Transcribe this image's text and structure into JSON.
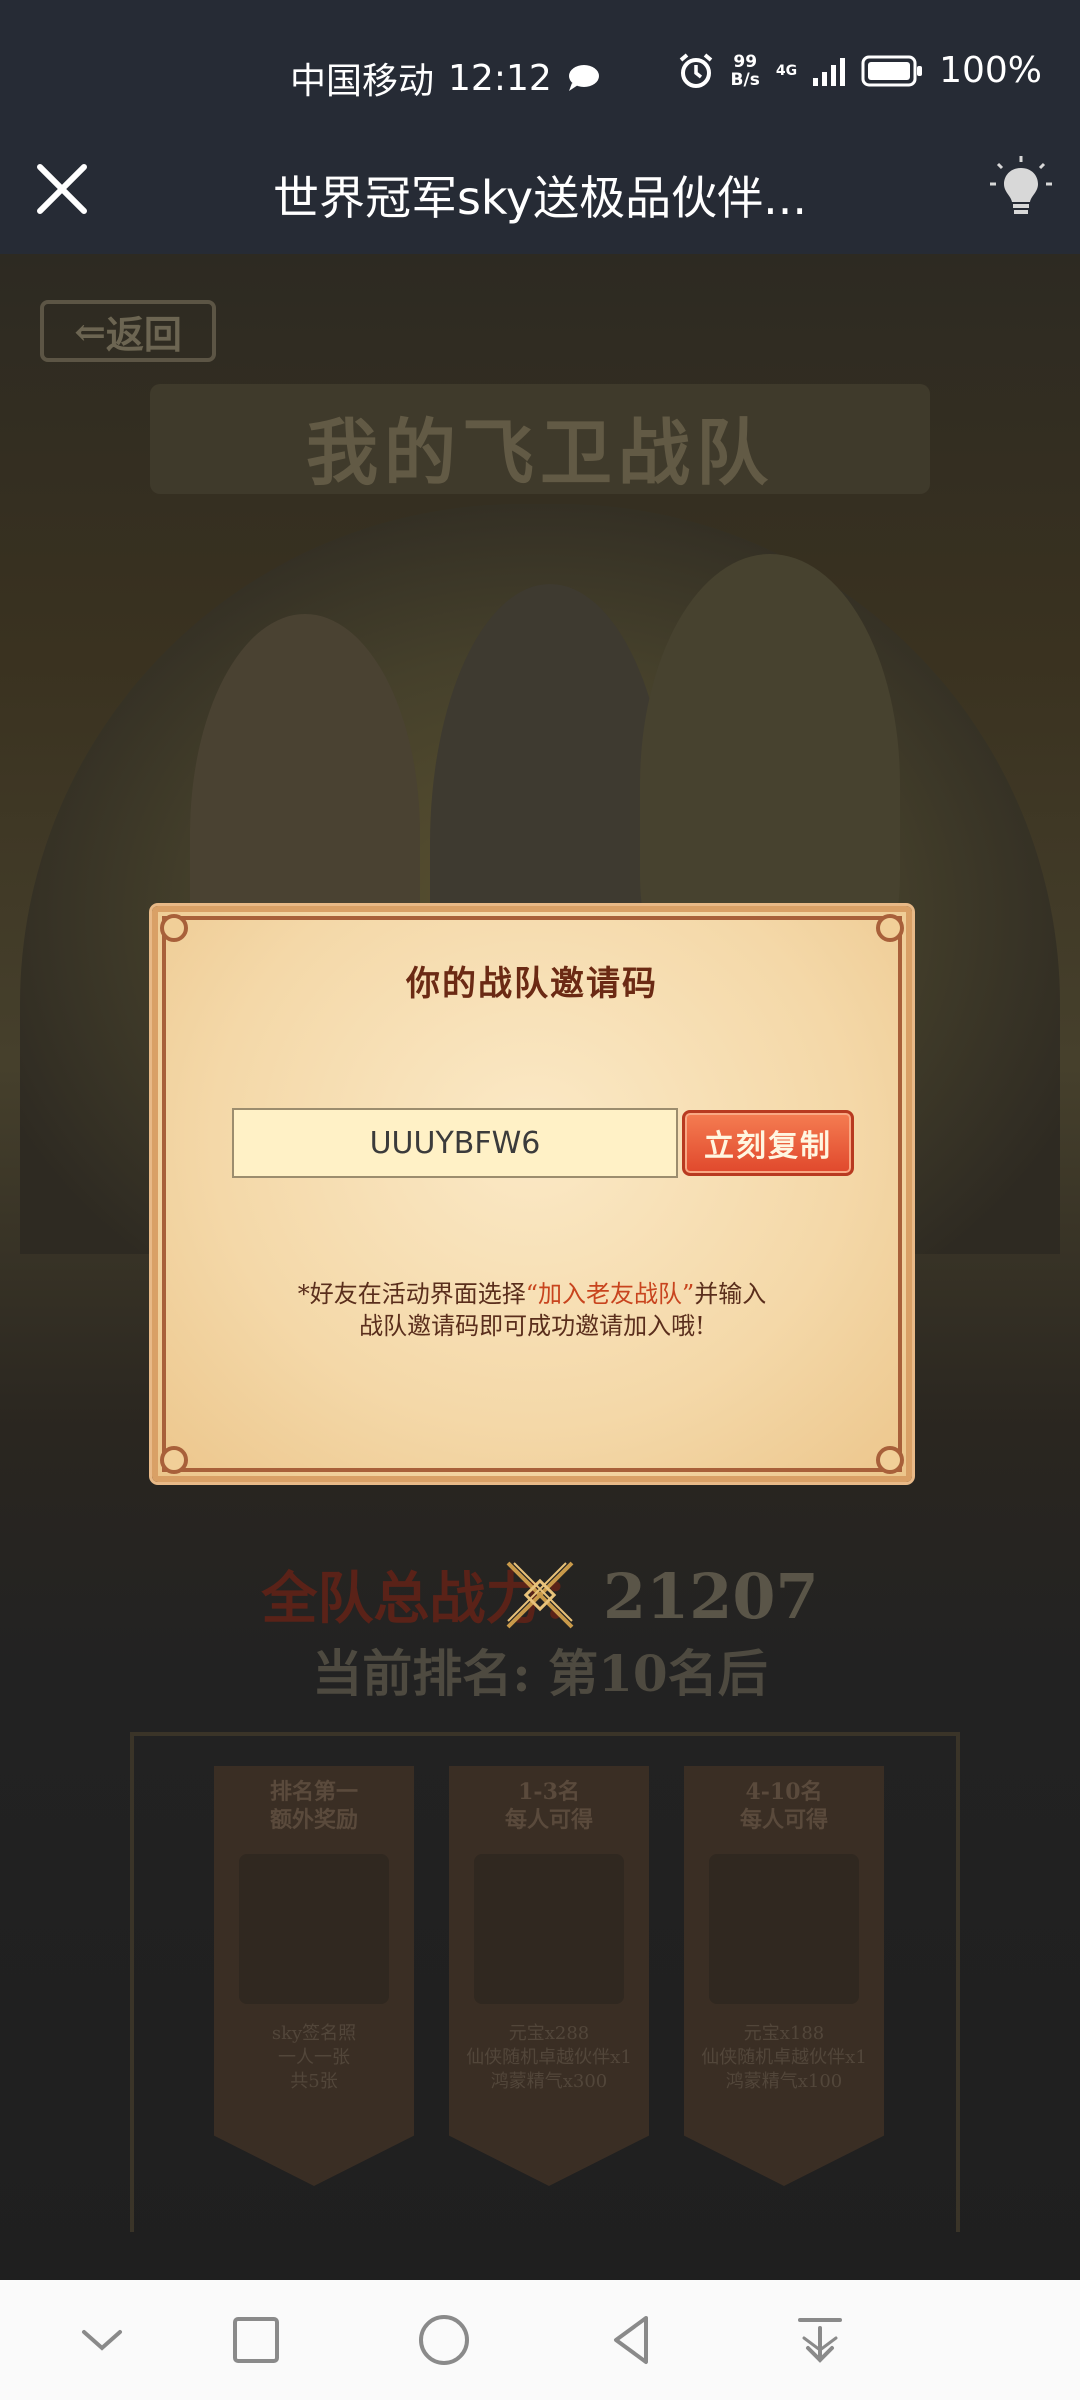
{
  "status_bar": {
    "carrier": "中国移动",
    "time": "12:12",
    "speed_value": "99",
    "speed_unit": "B/s",
    "network": "4G",
    "battery": "100%"
  },
  "title_bar": {
    "title": "世界冠军sky送极品伙伴..."
  },
  "page": {
    "back_label": "返回",
    "heading": "我的飞卫战队",
    "power_label": "全队总战力：",
    "power_value": "21207",
    "rank_text": "当前排名: 第10名后",
    "rewards": [
      {
        "head1": "排名第一",
        "head2": "额外奖励",
        "foot1": "sky签名照",
        "foot2": "一人一张",
        "foot3": "共5张"
      },
      {
        "head1": "1-3名",
        "head2": "每人可得",
        "foot1": "元宝x288",
        "foot2": "仙侠随机卓越伙伴x1",
        "foot3": "鸿蒙精气x300"
      },
      {
        "head1": "4-10名",
        "head2": "每人可得",
        "foot1": "元宝x188",
        "foot2": "仙侠随机卓越伙伴x1",
        "foot3": "鸿蒙精气x100"
      }
    ]
  },
  "modal": {
    "title": "你的战队邀请码",
    "invite_code": "UUUYBFW6",
    "copy_label": "立刻复制",
    "hint_prefix": "*好友在活动界面选择",
    "hint_highlight": "“加入老友战队”",
    "hint_suffix": "并输入",
    "hint_line2": "战队邀请码即可成功邀请加入哦!"
  },
  "colors": {
    "status_bg": "#262b35",
    "modal_bg": "#f4d8a8",
    "copy_button": "#e0482c",
    "highlight_text": "#c8441e"
  },
  "icons": {
    "close": "close-icon",
    "bulb": "bulb-icon",
    "modal_close": "modal-close-icon",
    "nav": [
      "chevron-down-icon",
      "square-icon",
      "circle-icon",
      "back-triangle-icon",
      "download-icon"
    ]
  }
}
